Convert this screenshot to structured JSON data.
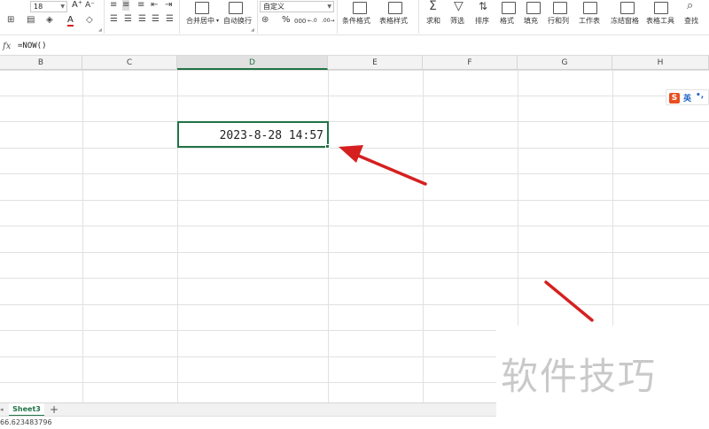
{
  "ribbon": {
    "font_size": "18",
    "number_format": "自定义",
    "buttons": {
      "merge_center": "合并居中",
      "wrap_text": "自动换行",
      "conditional_format": "条件格式",
      "table_style": "表格样式",
      "sum": "求和",
      "filter": "筛选",
      "sort": "排序",
      "format": "格式",
      "fill": "填充",
      "row_col": "行和列",
      "worksheet": "工作表",
      "freeze": "冻结窗格",
      "table_tools": "表格工具",
      "find": "查找"
    },
    "glyphs": {
      "percent": "%",
      "thousands": "000",
      "decimal_inc": "←.0",
      "decimal_dec": ".00→",
      "increase_font": "A⁺",
      "decrease_font": "A⁻",
      "font_color": "A"
    }
  },
  "formula_bar": {
    "fx": "fx",
    "formula": "=NOW()"
  },
  "columns": [
    {
      "label": "B"
    },
    {
      "label": "C"
    },
    {
      "label": "D"
    },
    {
      "label": "E"
    },
    {
      "label": "F"
    },
    {
      "label": "G"
    },
    {
      "label": "H"
    }
  ],
  "active_cell": {
    "value": "2023-8-28  14:57"
  },
  "ime": {
    "logo": "S",
    "lang": "英",
    "punct": "•,"
  },
  "watermark": "软件技巧",
  "sheet_tabs": [
    {
      "label": "Sheet3"
    }
  ],
  "tab_add": "+",
  "status": {
    "text": "66.623483796"
  },
  "colors": {
    "accent": "#217346",
    "arrow": "#d62020"
  }
}
